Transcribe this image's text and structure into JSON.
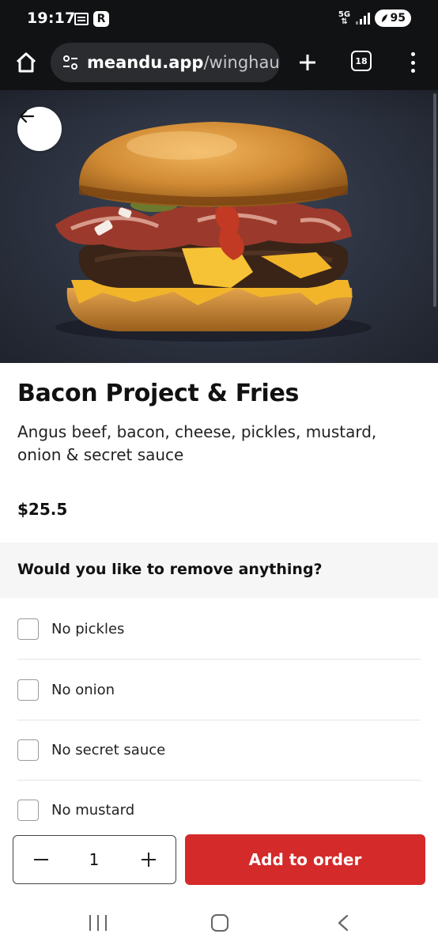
{
  "status_bar": {
    "time": "19:17",
    "network": "5G",
    "battery": "95"
  },
  "browser": {
    "url_domain": "meandu.app",
    "url_path": "/winghau",
    "tab_count": "18"
  },
  "item": {
    "title": "Bacon Project & Fries",
    "description": "Angus beef, bacon, cheese, pickles, mustard, onion & secret sauce",
    "price": "$25.5"
  },
  "remove_section": {
    "title": "Would you like to remove anything?",
    "options": [
      {
        "label": "No pickles",
        "checked": false
      },
      {
        "label": "No onion",
        "checked": false
      },
      {
        "label": "No secret sauce",
        "checked": false
      },
      {
        "label": "No mustard",
        "checked": false
      }
    ]
  },
  "order": {
    "quantity": "1",
    "add_label": "Add to order",
    "accent_color": "#d42a2a"
  }
}
